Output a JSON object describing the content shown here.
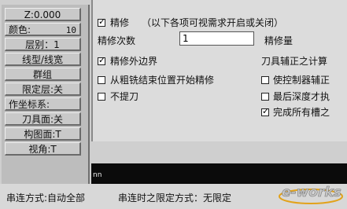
{
  "left_panel": {
    "z_label": "Z:0.000",
    "color_label": "颜色:",
    "color_value": "10",
    "level_label": "层别：1",
    "line_style_label": "线型/线宽",
    "group_label": "群组",
    "limit_layer_label": "限定层:关",
    "work_coords_label": "作坐标系:",
    "tool_plane_label": "刀具面:关",
    "construct_plane_label": "构图面:T",
    "view_label": "视角:T"
  },
  "dialog": {
    "finish_pass_label": "精修",
    "finish_note": "（以下各项可视需求开启或关闭）",
    "finish_count_label": "精修次数",
    "finish_count_value": "1",
    "finish_amount_label": "精修量",
    "finish_outer_label": "精修外边界",
    "tool_comp_label": "刀具辅正之计算",
    "rough_start_label": "从粗铣结束位置开始精修",
    "controller_comp_label": "使控制器辅正",
    "no_lift_label": "不提刀",
    "last_depth_label": "最后深度才执",
    "complete_all_label": "完成所有槽之"
  },
  "bottom": {
    "nn_text": "nn",
    "chain_mode_label": "串连方式:自动全部",
    "chain_limit_label": "串连时之限定方式：无限定"
  },
  "logo_text": "e-works",
  "checkboxes": {
    "finish_pass": true,
    "finish_outer": true,
    "rough_start": false,
    "no_lift": false,
    "controller_comp": false,
    "last_depth": false,
    "complete_all": true
  },
  "colors": {
    "panel": "#bdbdbd",
    "dialog": "#dcdcdc",
    "black_bar": "#0b0b0b",
    "logo": "#e2a21a"
  }
}
